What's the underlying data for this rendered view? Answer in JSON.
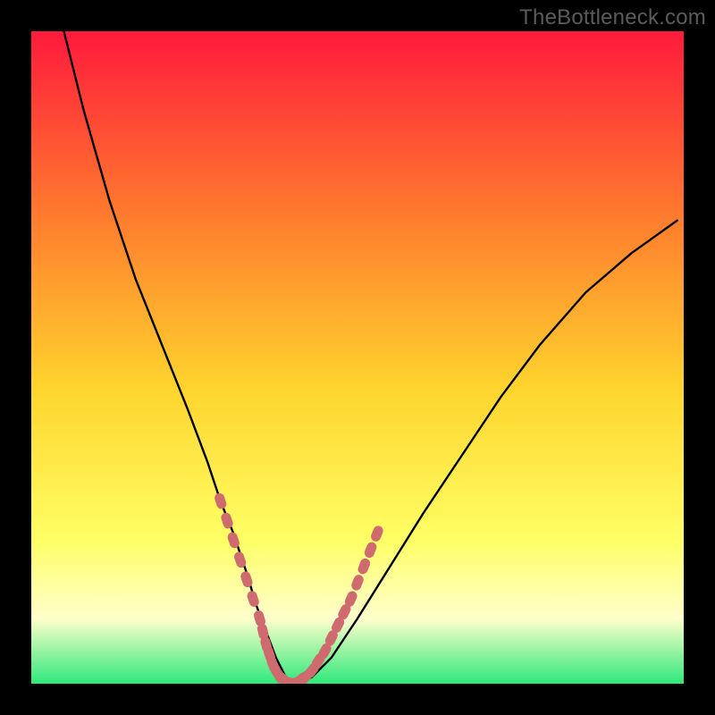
{
  "watermark": "TheBottleneck.com",
  "colors": {
    "page_bg": "#000000",
    "gradient_top": "#ff1a3c",
    "gradient_upper_mid": "#ff7a2e",
    "gradient_mid": "#ffd52e",
    "gradient_lower_mid": "#ffff66",
    "gradient_haze": "#ffffcc",
    "gradient_bottom": "#2ee87a",
    "curve": "#000000",
    "marker": "#cf6a6f"
  },
  "chart_data": {
    "type": "line",
    "title": "",
    "xlabel": "",
    "ylabel": "",
    "xlim": [
      0,
      100
    ],
    "ylim": [
      0,
      100
    ],
    "grid": false,
    "legend": false,
    "series": [
      {
        "name": "primary-curve",
        "x": [
          5,
          8,
          12,
          16,
          20,
          24,
          27,
          29,
          31,
          33,
          34.5,
          36,
          37.5,
          39,
          41,
          43,
          46,
          50,
          55,
          60,
          66,
          72,
          78,
          85,
          92,
          99
        ],
        "y": [
          100,
          88,
          74,
          62,
          52,
          42,
          34,
          28,
          23,
          17,
          12,
          8,
          4,
          1,
          0,
          1,
          4,
          10,
          18,
          26,
          35,
          44,
          52,
          60,
          66,
          71
        ]
      },
      {
        "name": "marker-band-left",
        "x": [
          29,
          30,
          31,
          32,
          33,
          34,
          35,
          35.5,
          36,
          36.5,
          37,
          37.5,
          38
        ],
        "y": [
          28,
          25,
          22,
          19,
          16,
          13,
          10,
          8,
          6,
          4.5,
          3,
          2,
          1.2
        ]
      },
      {
        "name": "marker-band-right",
        "x": [
          42,
          43,
          44,
          45,
          46,
          47,
          48,
          49,
          50,
          51,
          52,
          53
        ],
        "y": [
          1,
          2,
          3.5,
          5,
          7,
          9,
          11,
          13,
          15.5,
          18,
          20.5,
          23
        ]
      },
      {
        "name": "marker-band-bottom",
        "x": [
          38.5,
          39,
          39.5,
          40,
          40.5,
          41,
          41.5
        ],
        "y": [
          0.8,
          0.4,
          0.2,
          0.1,
          0.2,
          0.4,
          0.8
        ]
      }
    ],
    "annotations": []
  }
}
